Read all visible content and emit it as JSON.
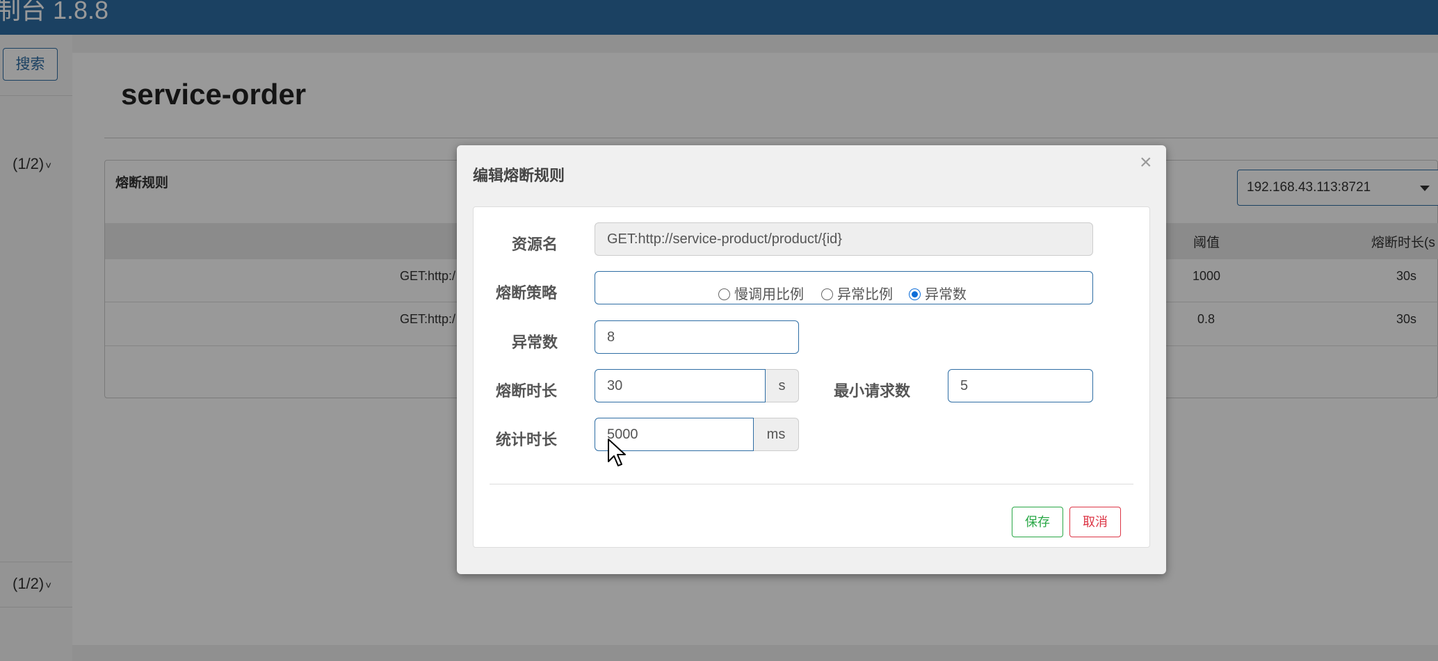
{
  "app": {
    "brand": "制台 1.8.8"
  },
  "sidebar": {
    "search_label": "搜索",
    "machine_counts": [
      "(1/2)",
      "(1/2)"
    ],
    "chevron": "˅"
  },
  "page": {
    "title": "service-order"
  },
  "rules_panel": {
    "heading": "熔断规则",
    "machine_select": {
      "value": "192.168.43.113:8721"
    },
    "columns": {
      "threshold": "阈值",
      "duration": "熔断时长(s"
    },
    "rows": [
      {
        "resource": "GET:http:/",
        "threshold": "1000",
        "duration": "30s"
      },
      {
        "resource": "GET:http:/",
        "threshold": "0.8",
        "duration": "30s"
      }
    ]
  },
  "modal": {
    "title": "编辑熔断规则",
    "close": "×",
    "resource": {
      "label": "资源名",
      "value": "GET:http://service-product/product/{id}"
    },
    "strategy": {
      "label": "熔断策略",
      "options": [
        "慢调用比例",
        "异常比例",
        "异常数"
      ],
      "selected": "异常数"
    },
    "exception_count": {
      "label": "异常数",
      "value": "8"
    },
    "break_duration": {
      "label": "熔断时长",
      "value": "30",
      "unit": "s"
    },
    "min_requests": {
      "label": "最小请求数",
      "value": "5"
    },
    "stat_interval": {
      "label": "统计时长",
      "value": "5000",
      "unit": "ms"
    },
    "save_label": "保存",
    "cancel_label": "取消"
  },
  "icons": {
    "close": "close-icon",
    "dropdown": "caret-down-icon",
    "cursor": "mouse-pointer-icon"
  }
}
